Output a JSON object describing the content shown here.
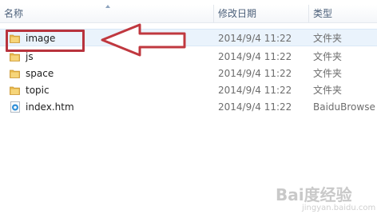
{
  "columns": {
    "name": "名称",
    "modified": "修改日期",
    "type": "类型"
  },
  "files": [
    {
      "name": "image",
      "modified": "2014/9/4 11:22",
      "type": "文件夹",
      "icon": "folder-icon"
    },
    {
      "name": "js",
      "modified": "2014/9/4 11:22",
      "type": "文件夹",
      "icon": "folder-icon"
    },
    {
      "name": "space",
      "modified": "2014/9/4 11:22",
      "type": "文件夹",
      "icon": "folder-icon"
    },
    {
      "name": "topic",
      "modified": "2014/9/4 11:22",
      "type": "文件夹",
      "icon": "folder-icon"
    },
    {
      "name": "index.htm",
      "modified": "2014/9/4 11:22",
      "type": "BaiduBrowse",
      "icon": "htm-file-icon"
    }
  ],
  "annotation": {
    "color": "#b8333d"
  },
  "watermark": {
    "main": "Bai度经验",
    "sub": "jingyan.baidu.com"
  }
}
